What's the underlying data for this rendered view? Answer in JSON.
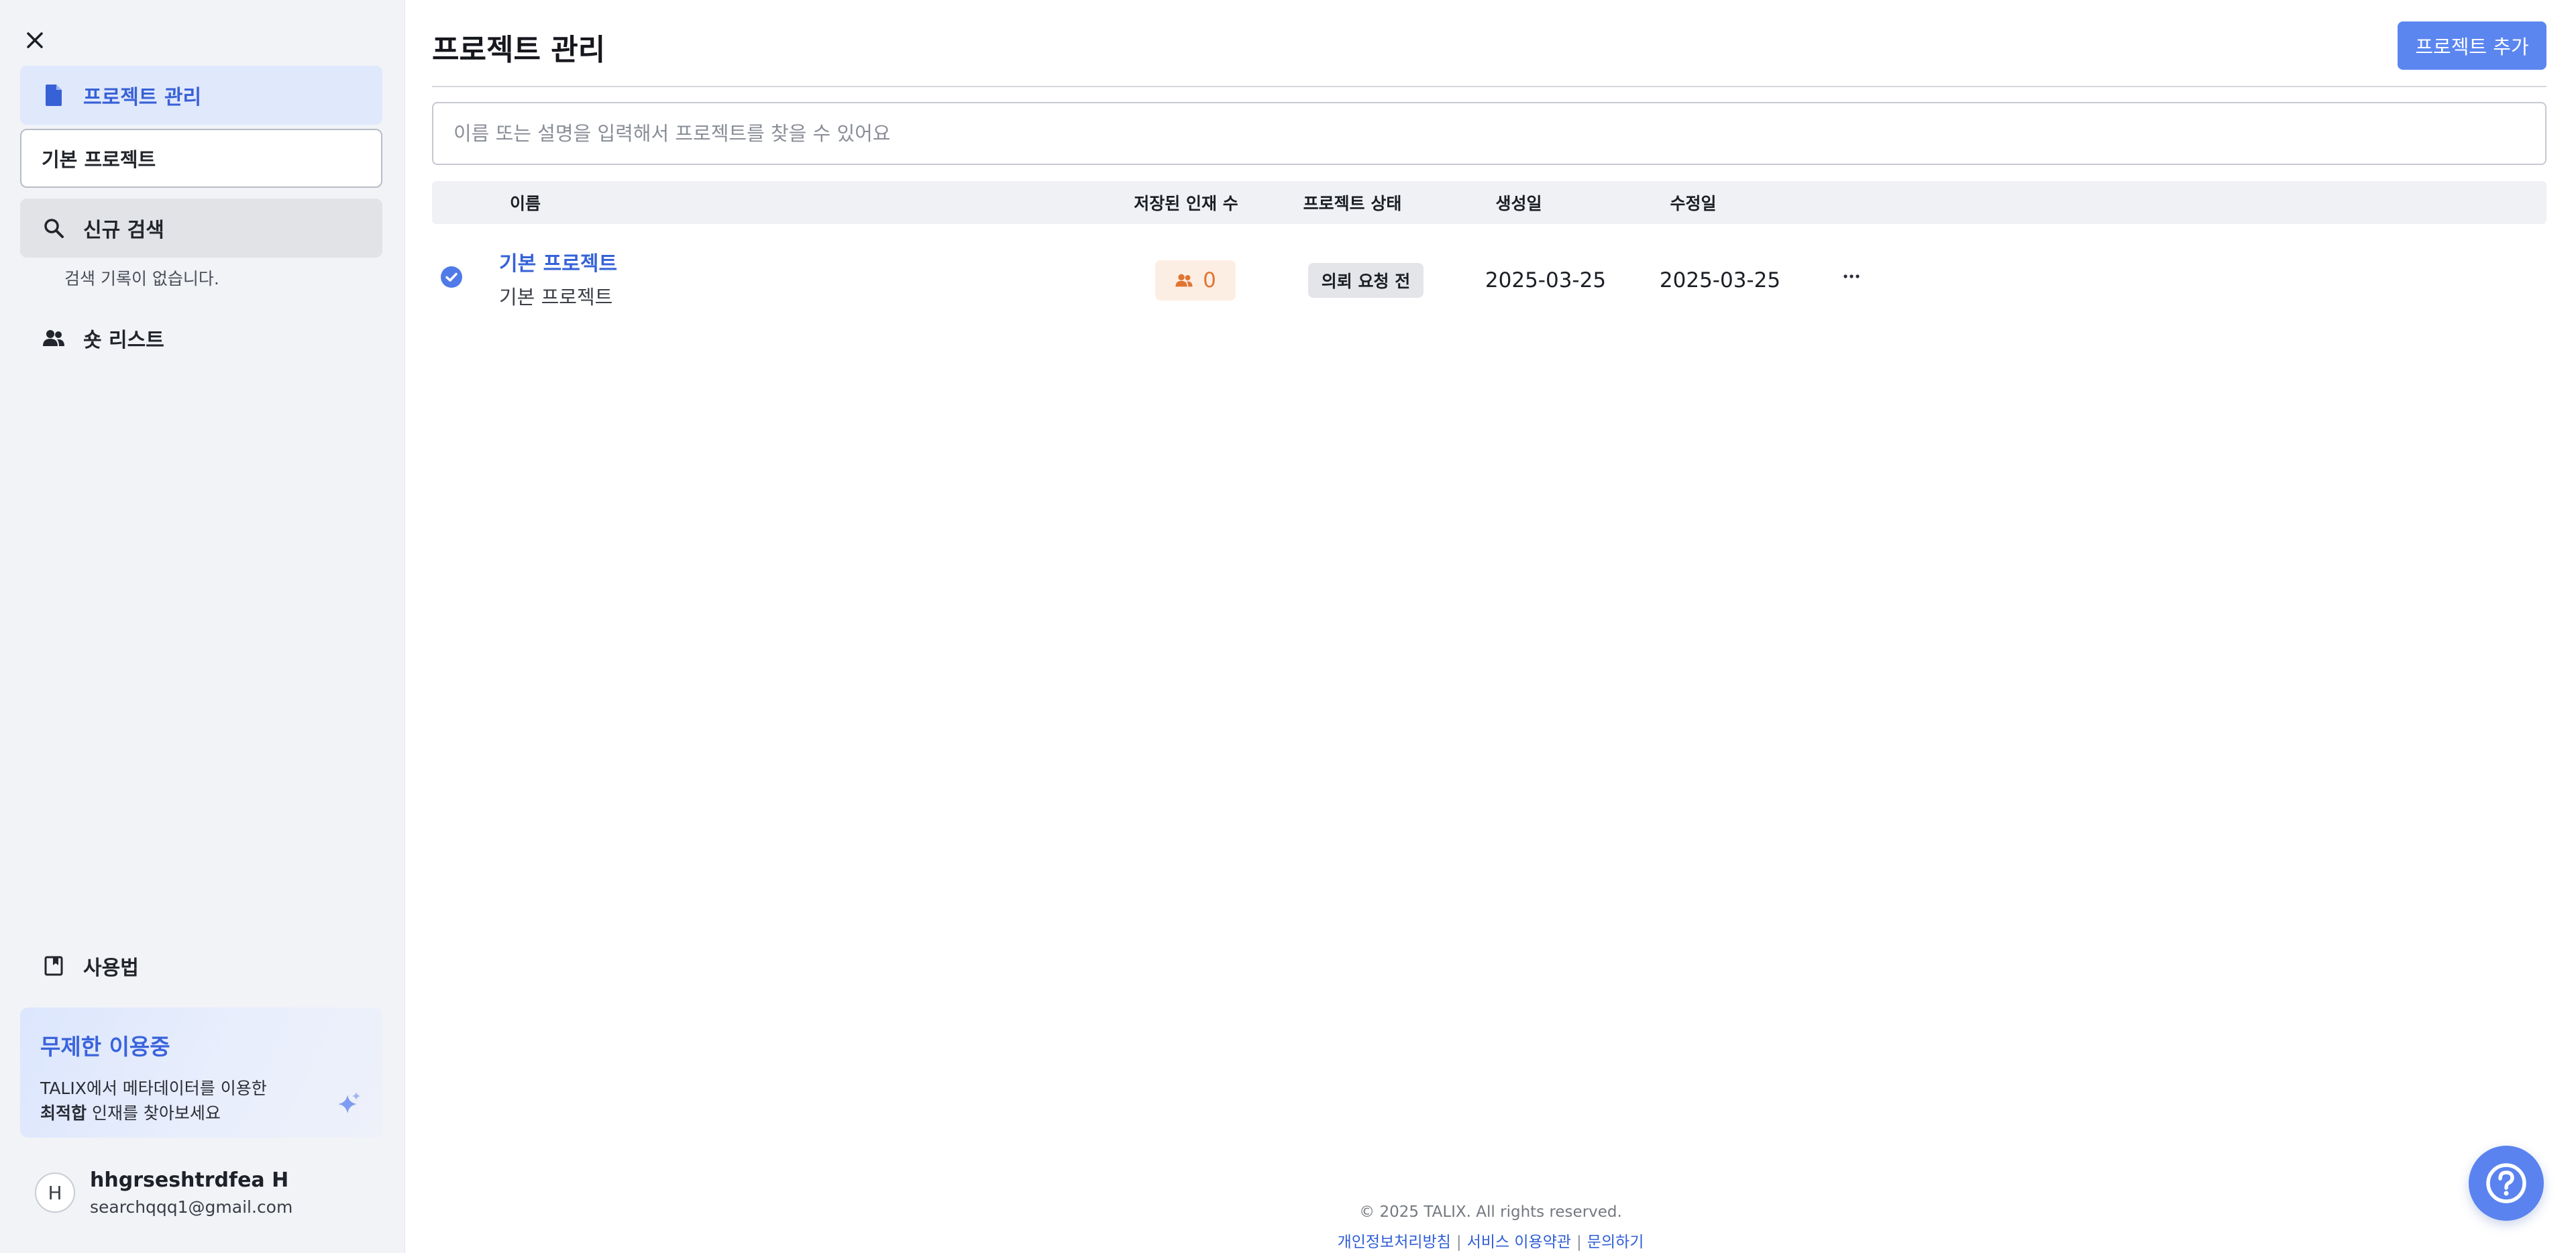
{
  "sidebar": {
    "nav": {
      "project_manage": "프로젝트 관리",
      "default_project": "기본 프로젝트",
      "new_search": "신규 검색",
      "no_history": "검색 기록이 없습니다.",
      "shortlist": "숏 리스트",
      "guide": "사용법"
    },
    "promo": {
      "title": "무제한 이용중",
      "line1": "TALIX에서 메타데이터를 이용한",
      "line2_bold": "최적합",
      "line2_rest": " 인재를 찾아보세요"
    },
    "user": {
      "initial": "H",
      "name": "hhgrseshtrdfea H",
      "email": "searchqqq1@gmail.com"
    }
  },
  "main": {
    "title": "프로젝트 관리",
    "add_button": "프로젝트 추가",
    "search_placeholder": "이름 또는 설명을 입력해서 프로젝트를 찾을 수 있어요",
    "table": {
      "headers": {
        "name": "이름",
        "saved_count": "저장된 인재 수",
        "status": "프로젝트 상태",
        "created": "생성일",
        "modified": "수정일"
      },
      "rows": [
        {
          "name": "기본 프로젝트",
          "description": "기본 프로젝트",
          "saved_count": "0",
          "status": "의뢰 요청 전",
          "created": "2025-03-25",
          "modified": "2025-03-25",
          "more": "···"
        }
      ]
    },
    "footer": {
      "copyright": "© 2025 TALIX. All rights reserved.",
      "privacy": "개인정보처리방침",
      "terms": "서비스 이용약관",
      "contact": "문의하기",
      "separator": "|"
    }
  },
  "colors": {
    "accent": "#5b86f0",
    "link": "#3662d8",
    "count_badge_bg": "#fdeee4",
    "count_badge_text": "#e07532"
  },
  "icons": {
    "close": "close-icon",
    "document": "document-icon",
    "search": "search-icon",
    "users": "users-icon",
    "book": "book-icon",
    "sparkle": "sparkle-icon",
    "check": "check-circle-icon",
    "help": "help-icon"
  }
}
